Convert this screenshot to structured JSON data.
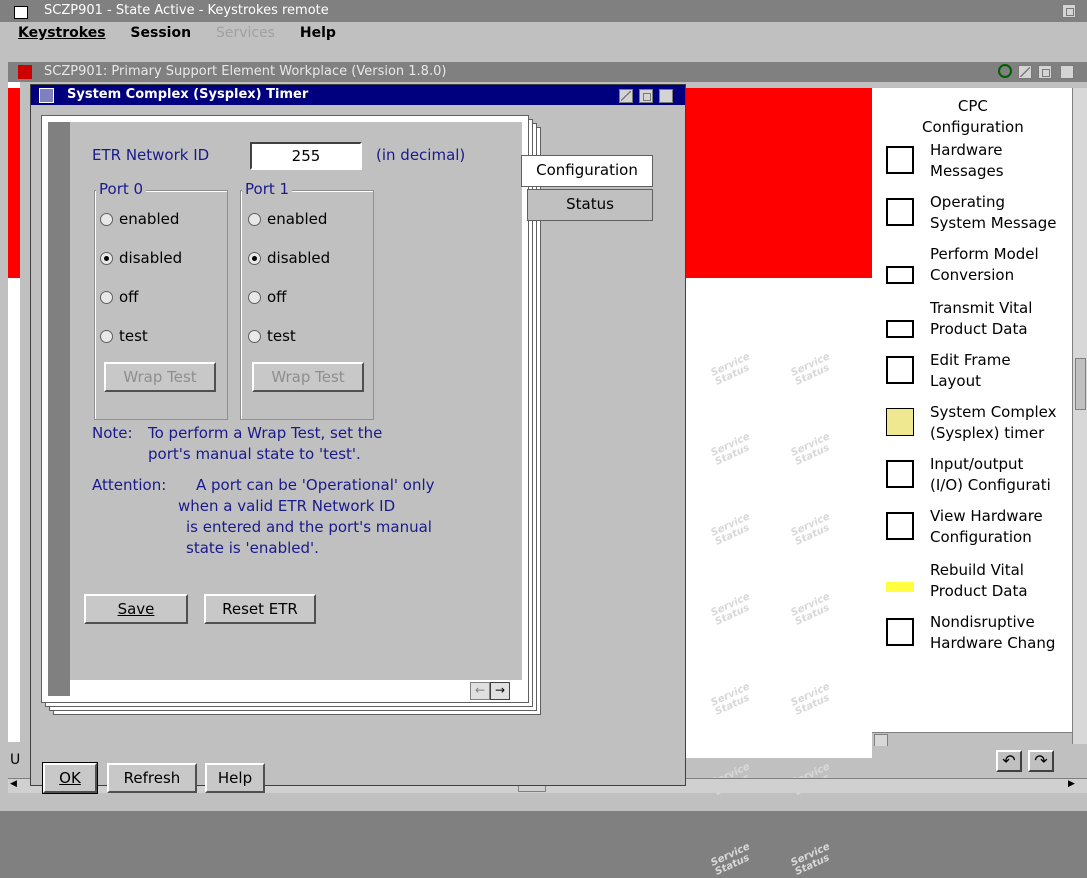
{
  "outer_window": {
    "title": "SCZP901 - State Active - Keystrokes remote",
    "menu": [
      "Keystrokes",
      "Session",
      "Services",
      "Help"
    ]
  },
  "workplace": {
    "title": "SCZP901: Primary Support Element Workplace (Version 1.8.0)",
    "status_left": "U",
    "watermark": "Service Status"
  },
  "tasks": [
    {
      "label": "CPC\nConfiguration",
      "icon": "cpc-configuration-icon"
    },
    {
      "label": "Hardware\nMessages",
      "icon": "hardware-messages-icon"
    },
    {
      "label": "Operating\nSystem Message",
      "icon": "operating-system-messages-icon"
    },
    {
      "label": "Perform Model\nConversion",
      "icon": "model-conversion-icon"
    },
    {
      "label": "Transmit Vital\nProduct Data",
      "icon": "transmit-vpd-icon"
    },
    {
      "label": "Edit Frame\nLayout",
      "icon": "edit-frame-icon"
    },
    {
      "label": "System Complex\n(Sysplex) timer",
      "icon": "hourglass-icon"
    },
    {
      "label": "Input/output\n(I/O) Configurati",
      "icon": "io-configuration-icon"
    },
    {
      "label": "View Hardware\nConfiguration",
      "icon": "view-hardware-icon"
    },
    {
      "label": "Rebuild Vital\nProduct Data",
      "icon": "rebuild-vpd-icon"
    },
    {
      "label": "Nondisruptive\nHardware Chang",
      "icon": "nondisruptive-change-icon"
    }
  ],
  "dialog": {
    "title": "System Complex (Sysplex) Timer",
    "etr_label": "ETR Network ID",
    "etr_value": "255",
    "etr_hint": "(in decimal)",
    "tabs": [
      "Configuration",
      "Status"
    ],
    "ports": [
      {
        "label": "Port 0",
        "options": [
          "enabled",
          "disabled",
          "off",
          "test"
        ],
        "selected": "disabled",
        "wrap": "Wrap Test"
      },
      {
        "label": "Port 1",
        "options": [
          "enabled",
          "disabled",
          "off",
          "test"
        ],
        "selected": "disabled",
        "wrap": "Wrap Test"
      }
    ],
    "note_label": "Note:",
    "note_line1": "To perform a Wrap Test, set the",
    "note_line2": "port's manual state to 'test'.",
    "attn_label": "Attention:",
    "attn_line1": "A port can be 'Operational' only",
    "attn_line2": "when a valid ETR Network ID",
    "attn_line3": "is entered and the port's manual",
    "attn_line4": "state is 'enabled'.",
    "save": "Save",
    "reset": "Reset ETR",
    "ok": "OK",
    "refresh": "Refresh",
    "help": "Help"
  },
  "colors": {
    "accent_red": "#ff0000",
    "titlebar_blue": "#00007f",
    "text_blue": "#1a1a8c"
  }
}
